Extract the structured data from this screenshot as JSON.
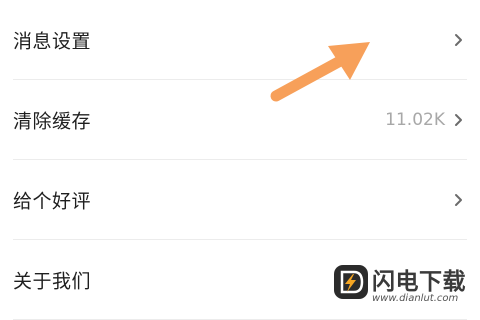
{
  "settings": {
    "items": [
      {
        "label": "消息设置",
        "value": ""
      },
      {
        "label": "清除缓存",
        "value": "11.02K"
      },
      {
        "label": "给个好评",
        "value": ""
      },
      {
        "label": "关于我们",
        "value": ""
      }
    ]
  },
  "annotation": {
    "arrow_color": "#f7a05a",
    "arrow_icon": "arrow-pointing-up-right"
  },
  "watermark": {
    "brand": "闪电下载",
    "site": "www.dianlut.com",
    "logo_icon": "lightning-bolt-icon",
    "logo_color": "#2b2b2b",
    "bolt_color": "#f5a623"
  },
  "colors": {
    "text": "#1f1f1f",
    "muted": "#a8a8a8",
    "separator": "#ececec"
  }
}
